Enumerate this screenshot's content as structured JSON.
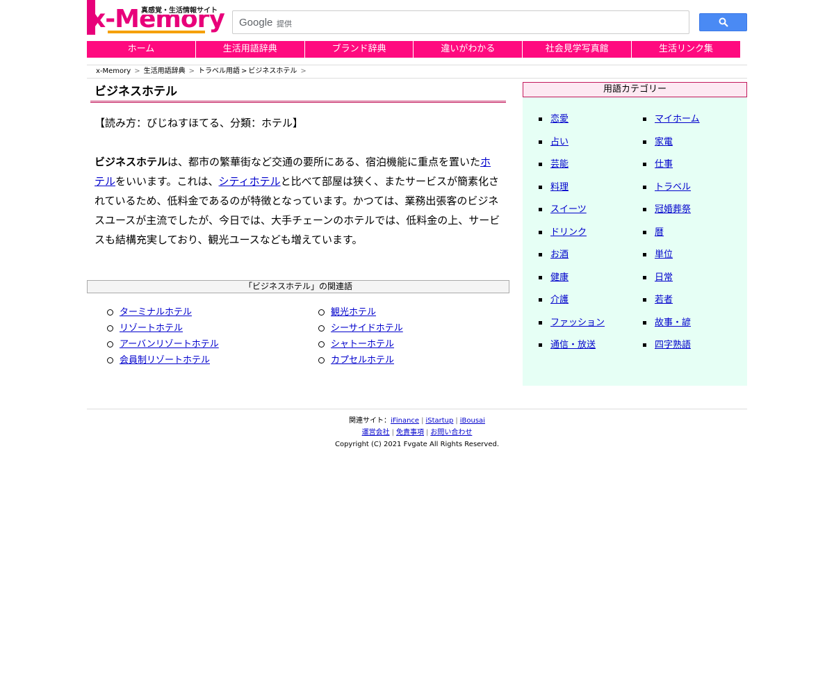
{
  "header": {
    "logo_text": "x-Memory",
    "tagline": "真感覚・生活情報サイト",
    "search": {
      "brand": "Google",
      "provided": "提供",
      "placeholder": ""
    }
  },
  "nav": [
    "ホーム",
    "生活用語辞典",
    "ブランド辞典",
    "違いがわかる",
    "社会見学写真館",
    "生活リンク集"
  ],
  "breadcrumb": {
    "items": [
      "x-Memory",
      "生活用語辞典",
      "トラベル用語",
      "ビジネスホテル"
    ]
  },
  "article": {
    "title": "ビジネスホテル",
    "reading": "【読み方：びじねすほてる、分類：ホテル】",
    "term": "ビジネスホテル",
    "p1": "は、都市の繁華街など交通の要所にある、宿泊機能に重点を置いた",
    "link1": "ホテル",
    "p2": "をいいます。これは、",
    "link2": "シティホテル",
    "p3": "と比べて部屋は狭く、またサービスが簡素化されているため、低料金であるのが特徴となっています。かつては、業務出張客のビジネスユースが主流でしたが、今日では、大手チェーンのホテルでは、低料金の上、サービスも結構充実しており、観光ユースなども増えています。"
  },
  "related": {
    "heading": "「ビジネスホテル」の関連語",
    "col1": [
      "ターミナルホテル",
      "リゾートホテル",
      "アーバンリゾートホテル",
      "会員制リゾートホテル"
    ],
    "col2": [
      "観光ホテル",
      "シーサイドホテル",
      "シャトーホテル",
      "カプセルホテル"
    ]
  },
  "categories": {
    "heading": "用語カテゴリー",
    "col1": [
      "恋愛",
      "占い",
      "芸能",
      "料理",
      "スイーツ",
      "ドリンク",
      "お酒",
      "健康",
      "介護",
      "ファッション",
      "通信・放送"
    ],
    "col2": [
      "マイホーム",
      "家電",
      "仕事",
      "トラベル",
      "冠婚葬祭",
      "暦",
      "単位",
      "日常",
      "若者",
      "故事・諺",
      "四字熟語"
    ]
  },
  "footer": {
    "related_label": "関連サイト：",
    "sites": [
      "iFinance",
      "iStartup",
      "iBousai"
    ],
    "links": [
      "運営会社",
      "免責事項",
      "お問い合わせ"
    ],
    "copyright": "Copyright (C) 2021 Fvgate All Rights Reserved."
  },
  "colors": {
    "nav_pink": "#ff0a7f",
    "sidebar_bg": "#e6fff5",
    "cat_head_bg": "#fde8f2",
    "accent_orange": "#f5a000"
  }
}
